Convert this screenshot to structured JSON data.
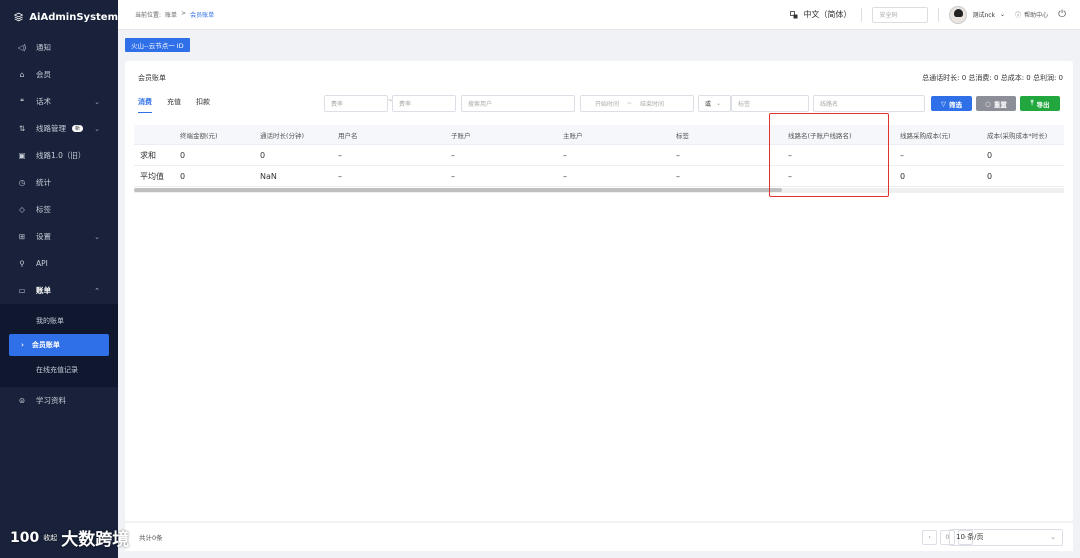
{
  "app": {
    "title": "AiAdminSystem"
  },
  "sidebar": {
    "items": [
      {
        "label": "通知",
        "icon": "sound-icon",
        "name": "sidebar-item-notice"
      },
      {
        "label": "会员",
        "icon": "member-icon",
        "name": "sidebar-item-member"
      },
      {
        "label": "话术",
        "icon": "quote-icon",
        "name": "sidebar-item-script",
        "chevron": "⌄"
      },
      {
        "label": "线路管理",
        "icon": "sort-icon",
        "name": "sidebar-item-lines",
        "chevron": "⌄",
        "badge": "新"
      },
      {
        "label": "线路1.0（旧）",
        "icon": "monitor-icon",
        "name": "sidebar-item-lines-old"
      },
      {
        "label": "统计",
        "icon": "clock-icon",
        "name": "sidebar-item-stats"
      },
      {
        "label": "标签",
        "icon": "tag-icon",
        "name": "sidebar-item-tags"
      },
      {
        "label": "设置",
        "icon": "grid-icon",
        "name": "sidebar-item-settings",
        "chevron": "⌄"
      },
      {
        "label": "API",
        "icon": "api-icon",
        "name": "sidebar-item-api"
      },
      {
        "label": "账单",
        "icon": "wallet-icon",
        "name": "sidebar-item-billing",
        "chevron": "⌃"
      }
    ],
    "billing_sub": [
      {
        "label": "我的账单"
      },
      {
        "label": "会员账单"
      },
      {
        "label": "在线充值记录"
      }
    ],
    "learning": {
      "label": "学习资料"
    }
  },
  "header": {
    "breadcrumb_prefix": "当前位置:",
    "breadcrumb_parent": "账单",
    "breadcrumb_sep": ">",
    "breadcrumb_current": "会员账单",
    "language": "中文（简体）",
    "security_placeholder": "安全码",
    "username": "测试nck",
    "help": "帮助中心"
  },
  "tagbar": {
    "tag": "火山--云节点一  ID"
  },
  "card": {
    "title": "会员账单",
    "totals": "总通话时长: 0  总消费: 0  总成本: 0  总利润: 0",
    "tabs": [
      "消费",
      "充值",
      "扣款"
    ],
    "filters": {
      "rate_min": "费率",
      "range_sep": "~",
      "rate_max": "费率",
      "search_user": "搜索用户",
      "start_time": "开始时间",
      "time_sep": "~",
      "end_time": "结束时间",
      "or_select": "或",
      "tag": "标签",
      "line_name": "线路名",
      "btn_filter": "筛选",
      "btn_reset": "重置",
      "btn_export": "导出"
    }
  },
  "table": {
    "columns": [
      "",
      "终端金额(元)",
      "通话时长(分钟)",
      "用户名",
      "子账户",
      "主账户",
      "标签",
      "线路名(子账户线路名)",
      "线路采购成本(元)",
      "成本(采购成本*时长)"
    ],
    "rows": [
      [
        "求和",
        "0",
        "0",
        "–",
        "–",
        "–",
        "–",
        "–",
        "–",
        "0"
      ],
      [
        "平均值",
        "0",
        "NaN",
        "–",
        "–",
        "–",
        "–",
        "–",
        "0",
        "0"
      ]
    ]
  },
  "footer": {
    "total": "共计0条",
    "page": "0",
    "page_size": "10 条/页"
  },
  "brand": {
    "mark": "100",
    "text": "大数跨境",
    "small": "收起"
  },
  "colors": {
    "primary": "#2f6fe8",
    "sidebar": "#19223a",
    "export": "#22a73f",
    "reset": "#8c8f97",
    "highlight": "#e0322e"
  }
}
